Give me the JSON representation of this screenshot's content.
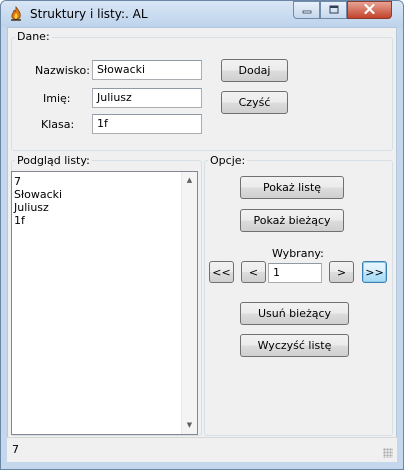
{
  "window": {
    "title": "Struktury i listy:. AL",
    "icon": "app-flame-icon",
    "controls": [
      "minimize-icon",
      "maximize-icon",
      "close-icon"
    ]
  },
  "dane": {
    "group_label": "Dane:",
    "nazwisko_label": "Nazwisko:",
    "nazwisko_value": "Słowacki",
    "imie_label": "Imię:",
    "imie_value": "Juliusz",
    "klasa_label": "Klasa:",
    "klasa_value": "1f",
    "dodaj_label": "Dodaj",
    "czysc_label": "Czyść"
  },
  "podglad": {
    "group_label": "Podgląd listy:",
    "lines": [
      "7",
      "Słowacki",
      "Juliusz",
      "1f"
    ]
  },
  "opcje": {
    "group_label": "Opcje:",
    "pokaz_liste_label": "Pokaż listę",
    "pokaz_biezacy_label": "Pokaż bieżący",
    "wybrany_label": "Wybrany:",
    "wybrany_value": "1",
    "first_label": "<<",
    "prev_label": "<",
    "next_label": ">",
    "last_label": ">>",
    "usun_label": "Usuń bieżący",
    "wyczysc_label": "Wyczyść listę"
  },
  "status": {
    "text": "7"
  },
  "colors": {
    "frame": "#c4d7ec",
    "close_button": "#c2432b",
    "focus": "#3c7fb1"
  }
}
